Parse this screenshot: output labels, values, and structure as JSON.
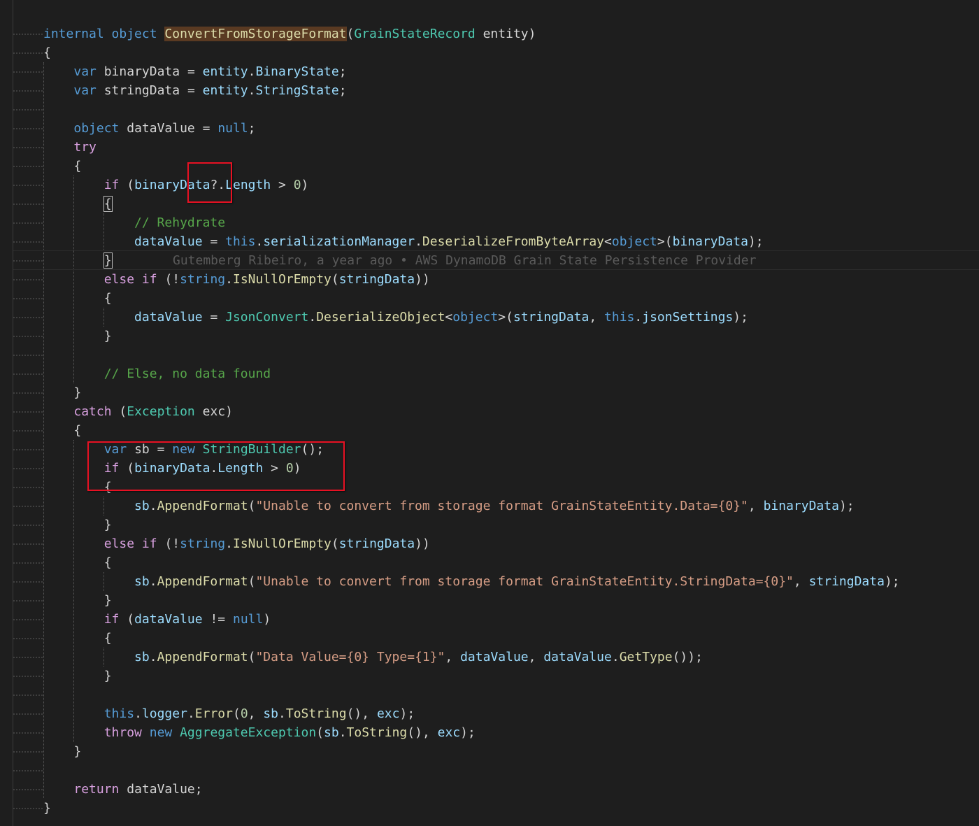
{
  "editor": {
    "blame_annotation": "Gutemberg Ribeiro, a year ago • AWS DynamoDB Grain State Persistence Provider",
    "code": {
      "l01": {
        "kw1": "internal",
        "kw2": "object",
        "method": "ConvertFromStorageFormat",
        "p1": "(",
        "type": "GrainStateRecord",
        "param": "entity",
        "p2": ")"
      },
      "l02": {
        "brace": "{"
      },
      "l03": {
        "kw": "var",
        "name": "binaryData",
        "op": "=",
        "obj": "entity",
        "dot": ".",
        "prop": "BinaryState",
        "semi": ";"
      },
      "l04": {
        "kw": "var",
        "name": "stringData",
        "op": "=",
        "obj": "entity",
        "dot": ".",
        "prop": "StringState",
        "semi": ";"
      },
      "l05": {
        "kw": "object",
        "name": "dataValue",
        "op": "=",
        "val": "null",
        "semi": ";"
      },
      "l06": {
        "kw": "try"
      },
      "l07": {
        "brace": "{"
      },
      "l08": {
        "kw": "if",
        "p1": "(",
        "name": "binaryData",
        "opt": "?.",
        "prop": "Length",
        "op": ">",
        "num": "0",
        "p2": ")"
      },
      "l09": {
        "brace": "{"
      },
      "l10": {
        "comment": "// Rehydrate"
      },
      "l11": {
        "name": "dataValue",
        "op": "=",
        "this": "this",
        "dot1": ".",
        "field": "serializationManager",
        "dot2": ".",
        "method": "DeserializeFromByteArray",
        "lt": "<",
        "gen": "object",
        "gt": ">",
        "p1": "(",
        "arg": "binaryData",
        "p2": ")",
        "semi": ";"
      },
      "l12": {
        "brace": "}"
      },
      "l13": {
        "kw1": "else",
        "kw2": "if",
        "p1": "(!",
        "type": "string",
        "dot": ".",
        "method": "IsNullOrEmpty",
        "p2": "(",
        "arg": "stringData",
        "p3": "))"
      },
      "l14": {
        "brace": "{"
      },
      "l15": {
        "name": "dataValue",
        "op": "=",
        "cls": "JsonConvert",
        "dot1": ".",
        "method": "DeserializeObject",
        "lt": "<",
        "gen": "object",
        "gt": ">",
        "p1": "(",
        "arg1": "stringData",
        "comma": ",",
        "this": "this",
        "dot2": ".",
        "arg2": "jsonSettings",
        "p2": ")",
        "semi": ";"
      },
      "l16": {
        "brace": "}"
      },
      "l17": {
        "comment": "// Else, no data found"
      },
      "l18": {
        "brace": "}"
      },
      "l19": {
        "kw": "catch",
        "p1": "(",
        "type": "Exception",
        "name": "exc",
        "p2": ")"
      },
      "l20": {
        "brace": "{"
      },
      "l21": {
        "kw1": "var",
        "name": "sb",
        "op": "=",
        "kw2": "new",
        "type": "StringBuilder",
        "p": "()",
        "semi": ";"
      },
      "l22": {
        "kw": "if",
        "p1": "(",
        "name": "binaryData",
        "dot": ".",
        "prop": "Length",
        "op": ">",
        "num": "0",
        "p2": ")"
      },
      "l23": {
        "brace": "{"
      },
      "l24": {
        "obj": "sb",
        "dot": ".",
        "method": "AppendFormat",
        "p1": "(",
        "str": "\"Unable to convert from storage format GrainStateEntity.Data={0}\"",
        "comma": ",",
        "arg": "binaryData",
        "p2": ")",
        "semi": ";"
      },
      "l25": {
        "brace": "}"
      },
      "l26": {
        "kw1": "else",
        "kw2": "if",
        "p1": "(!",
        "type": "string",
        "dot": ".",
        "method": "IsNullOrEmpty",
        "p2": "(",
        "arg": "stringData",
        "p3": "))"
      },
      "l27": {
        "brace": "{"
      },
      "l28": {
        "obj": "sb",
        "dot": ".",
        "method": "AppendFormat",
        "p1": "(",
        "str": "\"Unable to convert from storage format GrainStateEntity.StringData={0}\"",
        "comma": ",",
        "arg": "stringData",
        "p2": ")",
        "semi": ";"
      },
      "l29": {
        "brace": "}"
      },
      "l30": {
        "kw": "if",
        "p1": "(",
        "name": "dataValue",
        "op": "!=",
        "val": "null",
        "p2": ")"
      },
      "l31": {
        "brace": "{"
      },
      "l32": {
        "obj": "sb",
        "dot1": ".",
        "method": "AppendFormat",
        "p1": "(",
        "str": "\"Data Value={0} Type={1}\"",
        "comma1": ",",
        "arg1": "dataValue",
        "comma2": ",",
        "arg2": "dataValue",
        "dot2": ".",
        "method2": "GetType",
        "p2": "())",
        "semi": ";"
      },
      "l33": {
        "brace": "}"
      },
      "l34": {
        "this": "this",
        "dot1": ".",
        "field": "logger",
        "dot2": ".",
        "method": "Error",
        "p1": "(",
        "num": "0",
        "comma1": ",",
        "obj": "sb",
        "dot3": ".",
        "method2": "ToString",
        "p2": "()",
        "comma2": ",",
        "arg": "exc",
        "p3": ")",
        "semi": ";"
      },
      "l35": {
        "kw1": "throw",
        "kw2": "new",
        "type": "AggregateException",
        "p1": "(",
        "obj": "sb",
        "dot": ".",
        "method": "ToString",
        "p2": "()",
        "comma": ",",
        "arg": "exc",
        "p3": ")",
        "semi": ";"
      },
      "l36": {
        "brace": "}"
      },
      "l37": {
        "kw": "return",
        "name": "dataValue",
        "semi": ";"
      },
      "l38": {
        "brace": "}"
      }
    }
  },
  "colors": {
    "background": "#1e1e1e",
    "keyword": "#569cd6",
    "control_keyword": "#d8a0df",
    "type": "#4ec9b0",
    "method": "#dcdcaa",
    "variable": "#9cdcfe",
    "string": "#d69d85",
    "number": "#b5cea8",
    "comment": "#57a64a",
    "annotation_box": "#e81123"
  }
}
